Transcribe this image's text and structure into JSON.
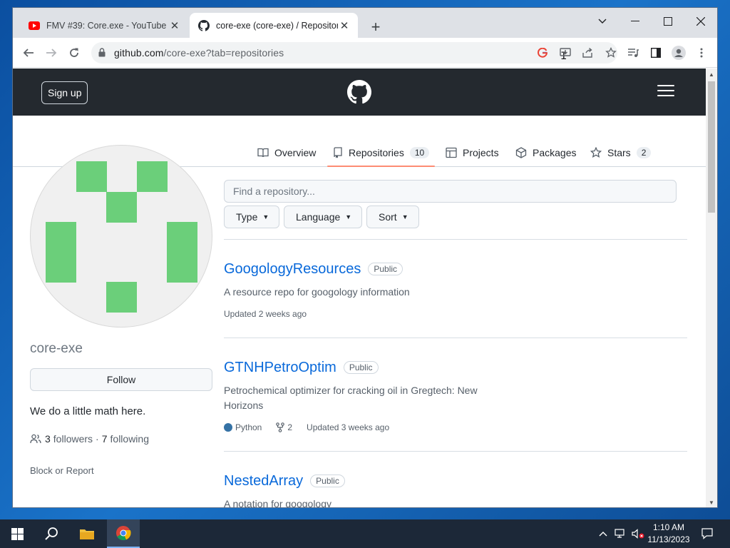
{
  "browser": {
    "tabs": [
      {
        "title": "FMV #39: Core.exe - YouTube",
        "favicon": "youtube-icon",
        "active": false
      },
      {
        "title": "core-exe (core-exe) / Repositories",
        "favicon": "github-icon",
        "active": true
      }
    ],
    "url_host": "github.com",
    "url_path": "/core-exe?tab=repositories"
  },
  "header": {
    "signup_label": "Sign up"
  },
  "nav": {
    "items": [
      {
        "label": "Overview",
        "icon": "book-icon"
      },
      {
        "label": "Repositories",
        "icon": "repo-icon",
        "count": "10",
        "selected": true
      },
      {
        "label": "Projects",
        "icon": "table-icon"
      },
      {
        "label": "Packages",
        "icon": "package-icon"
      },
      {
        "label": "Stars",
        "icon": "star-icon",
        "count": "2"
      }
    ]
  },
  "profile": {
    "username": "core-exe",
    "follow_label": "Follow",
    "bio": "We do a little math here.",
    "followers_count": "3",
    "followers_label": "followers",
    "separator": "·",
    "following_count": "7",
    "following_label": "following",
    "block_label": "Block or Report"
  },
  "filters": {
    "search_placeholder": "Find a repository...",
    "type_label": "Type",
    "language_label": "Language",
    "sort_label": "Sort"
  },
  "repos": [
    {
      "name": "GoogologyResources",
      "visibility": "Public",
      "description": "A resource repo for googology information",
      "updated": "Updated 2 weeks ago"
    },
    {
      "name": "GTNHPetroOptim",
      "visibility": "Public",
      "description": "Petrochemical optimizer for cracking oil in Gregtech: New Horizons",
      "language": "Python",
      "language_color": "#3572A5",
      "forks": "2",
      "updated": "Updated 3 weeks ago"
    },
    {
      "name": "NestedArray",
      "visibility": "Public",
      "description": "A notation for googology"
    }
  ],
  "taskbar": {
    "time": "1:10 AM",
    "date": "11/13/2023"
  },
  "colors": {
    "accent_link": "#0969da",
    "header_bg": "#24292f",
    "underline": "#fd8c73",
    "avatar_green": "#6bcf7a"
  }
}
